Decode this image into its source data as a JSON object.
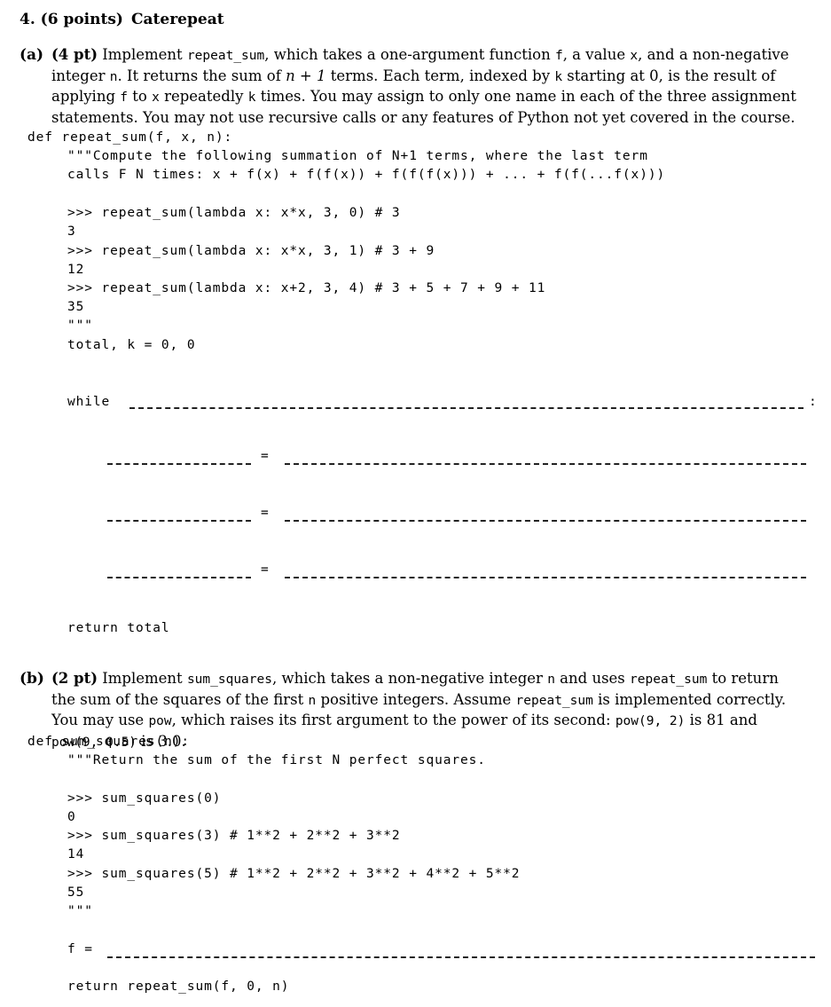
{
  "question": {
    "number_points": "4. (6 points)",
    "title": "Caterepeat"
  },
  "part_a": {
    "label": "(a)",
    "points": "(4 pt)",
    "description": {
      "t1": "Implement",
      "fn_name": "repeat_sum",
      "t2": ", which takes a one-argument function",
      "f": "f",
      "t3": ", a value",
      "x": "x",
      "t4": ", and a non-negative integer",
      "n": "n",
      "t5": ". It returns the sum of",
      "math": "n + 1",
      "t6": "terms. Each term, indexed by",
      "k": "k",
      "t7": "starting at 0, is the result of applying",
      "f2": "f",
      "t8": "to",
      "x2": "x",
      "t9": "repeatedly",
      "k2": "k",
      "t10": "times. You may assign to only one name in each of the three assignment statements. You may not use recursive calls or any features of Python not yet covered in the course."
    },
    "code": {
      "def_line": "def repeat_sum(f, x, n):",
      "doc1": "\"\"\"Compute the following summation of N+1 terms, where the last term",
      "doc2": "calls F N times: x + f(x) + f(f(x)) + f(f(f(x))) + ... + f(f(...f(x)))",
      "ex1": ">>> repeat_sum(lambda x: x*x, 3, 0) # 3",
      "out1": "3",
      "ex2": ">>> repeat_sum(lambda x: x*x, 3, 1) # 3 + 9",
      "out2": "12",
      "ex3": ">>> repeat_sum(lambda x: x+2, 3, 4) # 3 + 5 + 7 + 9 + 11",
      "out3": "35",
      "doc_end": "\"\"\"",
      "init": "total, k = 0, 0",
      "while_kw": "while",
      "colon": ":",
      "eq": "=",
      "ret": "return total"
    }
  },
  "part_b": {
    "label": "(b)",
    "points": "(2 pt)",
    "description": {
      "t1": "Implement",
      "fn_name": "sum_squares",
      "t2": ", which takes a non-negative integer",
      "n": "n",
      "t3": "and uses",
      "rs": "repeat_sum",
      "t4": "to return the sum of the squares of the first",
      "n2": "n",
      "t5": "positive integers. Assume",
      "rs2": "repeat_sum",
      "t6": "is implemented correctly. You may use",
      "pow": "pow",
      "t7": ", which raises its first argument to the power of its second:",
      "pow_ex1": "pow(9, 2)",
      "t8": "is 81 and",
      "pow_ex2": "pow(9, 0.5)",
      "t9": "is 3.0."
    },
    "code": {
      "def_line": "def sum_squares(n):",
      "doc1": "\"\"\"Return the sum of the first N perfect squares.",
      "ex1": ">>> sum_squares(0)",
      "out1": "0",
      "ex2": ">>> sum_squares(3) # 1**2 + 2**2 + 3**2",
      "out2": "14",
      "ex3": ">>> sum_squares(5) # 1**2 + 2**2 + 3**2 + 4**2 + 5**2",
      "out3": "55",
      "doc_end": "\"\"\"",
      "f_assign": "f =",
      "ret": "return repeat_sum(f, 0, n)"
    }
  }
}
